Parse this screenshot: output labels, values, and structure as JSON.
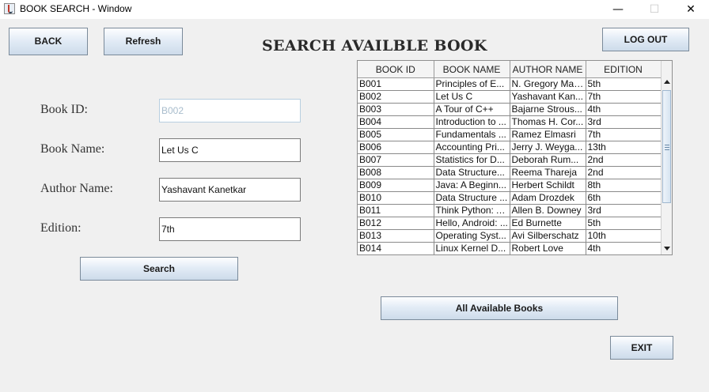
{
  "window": {
    "title": "BOOK SEARCH - Window",
    "min_glyph": "—",
    "max_glyph": "☐",
    "close_glyph": "✕"
  },
  "toolbar": {
    "back_label": "BACK",
    "refresh_label": "Refresh",
    "logout_label": "LOG OUT"
  },
  "heading": "SEARCH AVAILBLE BOOK",
  "form": {
    "book_id_label": "Book ID:",
    "book_id_value": "B002",
    "book_name_label": "Book Name:",
    "book_name_value": "Let Us C",
    "author_label": "Author Name:",
    "author_value": "Yashavant Kanetkar",
    "edition_label": "Edition:",
    "edition_value": "7th",
    "search_label": "Search"
  },
  "table": {
    "headers": [
      "BOOK ID",
      "BOOK NAME",
      "AUTHOR NAME",
      "EDITION"
    ],
    "rows": [
      [
        "B001",
        "Principles of E...",
        "N. Gregory Man...",
        "5th"
      ],
      [
        "B002",
        "Let Us C",
        "Yashavant Kan...",
        "7th"
      ],
      [
        "B003",
        "A Tour of C++",
        "Bajarne Strous...",
        "4th"
      ],
      [
        "B004",
        "Introduction to ...",
        "Thomas H. Cor...",
        "3rd"
      ],
      [
        "B005",
        "Fundamentals ...",
        "Ramez Elmasri",
        "7th"
      ],
      [
        "B006",
        "Accounting Pri...",
        "Jerry J. Weyga...",
        "13th"
      ],
      [
        "B007",
        "Statistics for D...",
        "Deborah Rum...",
        "2nd"
      ],
      [
        "B008",
        "Data Structure...",
        "Reema Thareja",
        "2nd"
      ],
      [
        "B009",
        "Java: A Beginn...",
        "Herbert Schildt",
        "8th"
      ],
      [
        "B010",
        "Data Structure ...",
        "Adam Drozdek",
        "6th"
      ],
      [
        "B011",
        "Think Python: A...",
        "Allen B. Downey",
        "3rd"
      ],
      [
        "B012",
        "Hello, Android: ...",
        "Ed Burnette",
        "5th"
      ],
      [
        "B013",
        "Operating Syst...",
        "Avi Silberschatz",
        "10th"
      ],
      [
        "B014",
        "Linux Kernel D...",
        "Robert Love",
        "4th"
      ]
    ]
  },
  "bottom": {
    "all_books_label": "All Available Books",
    "exit_label": "EXIT"
  }
}
